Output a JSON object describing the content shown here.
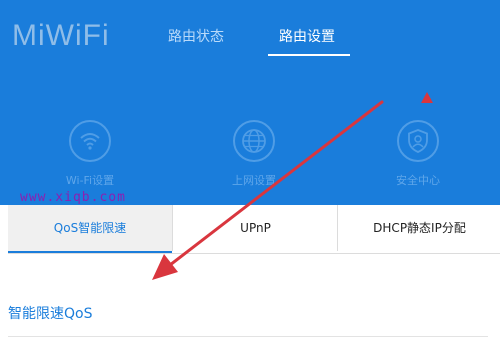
{
  "header": {
    "logo": "MiWiFi",
    "nav": [
      {
        "label": "路由状态"
      },
      {
        "label": "路由设置"
      }
    ],
    "menu": [
      {
        "label": "Wi-Fi设置",
        "icon": "wifi-icon"
      },
      {
        "label": "上网设置",
        "icon": "globe-icon"
      },
      {
        "label": "安全中心",
        "icon": "shield-user-icon"
      }
    ]
  },
  "watermark": "www.xiqb.com",
  "tabs": [
    {
      "label": "QoS智能限速"
    },
    {
      "label": "UPnP"
    },
    {
      "label": "DHCP静态IP分配"
    }
  ],
  "section": {
    "title": "智能限速QoS"
  },
  "colors": {
    "header_bg": "#1a7ddb",
    "active_tab": "#1a7ddb",
    "annotation": "#d9363e",
    "watermark": "#8b20b2"
  }
}
